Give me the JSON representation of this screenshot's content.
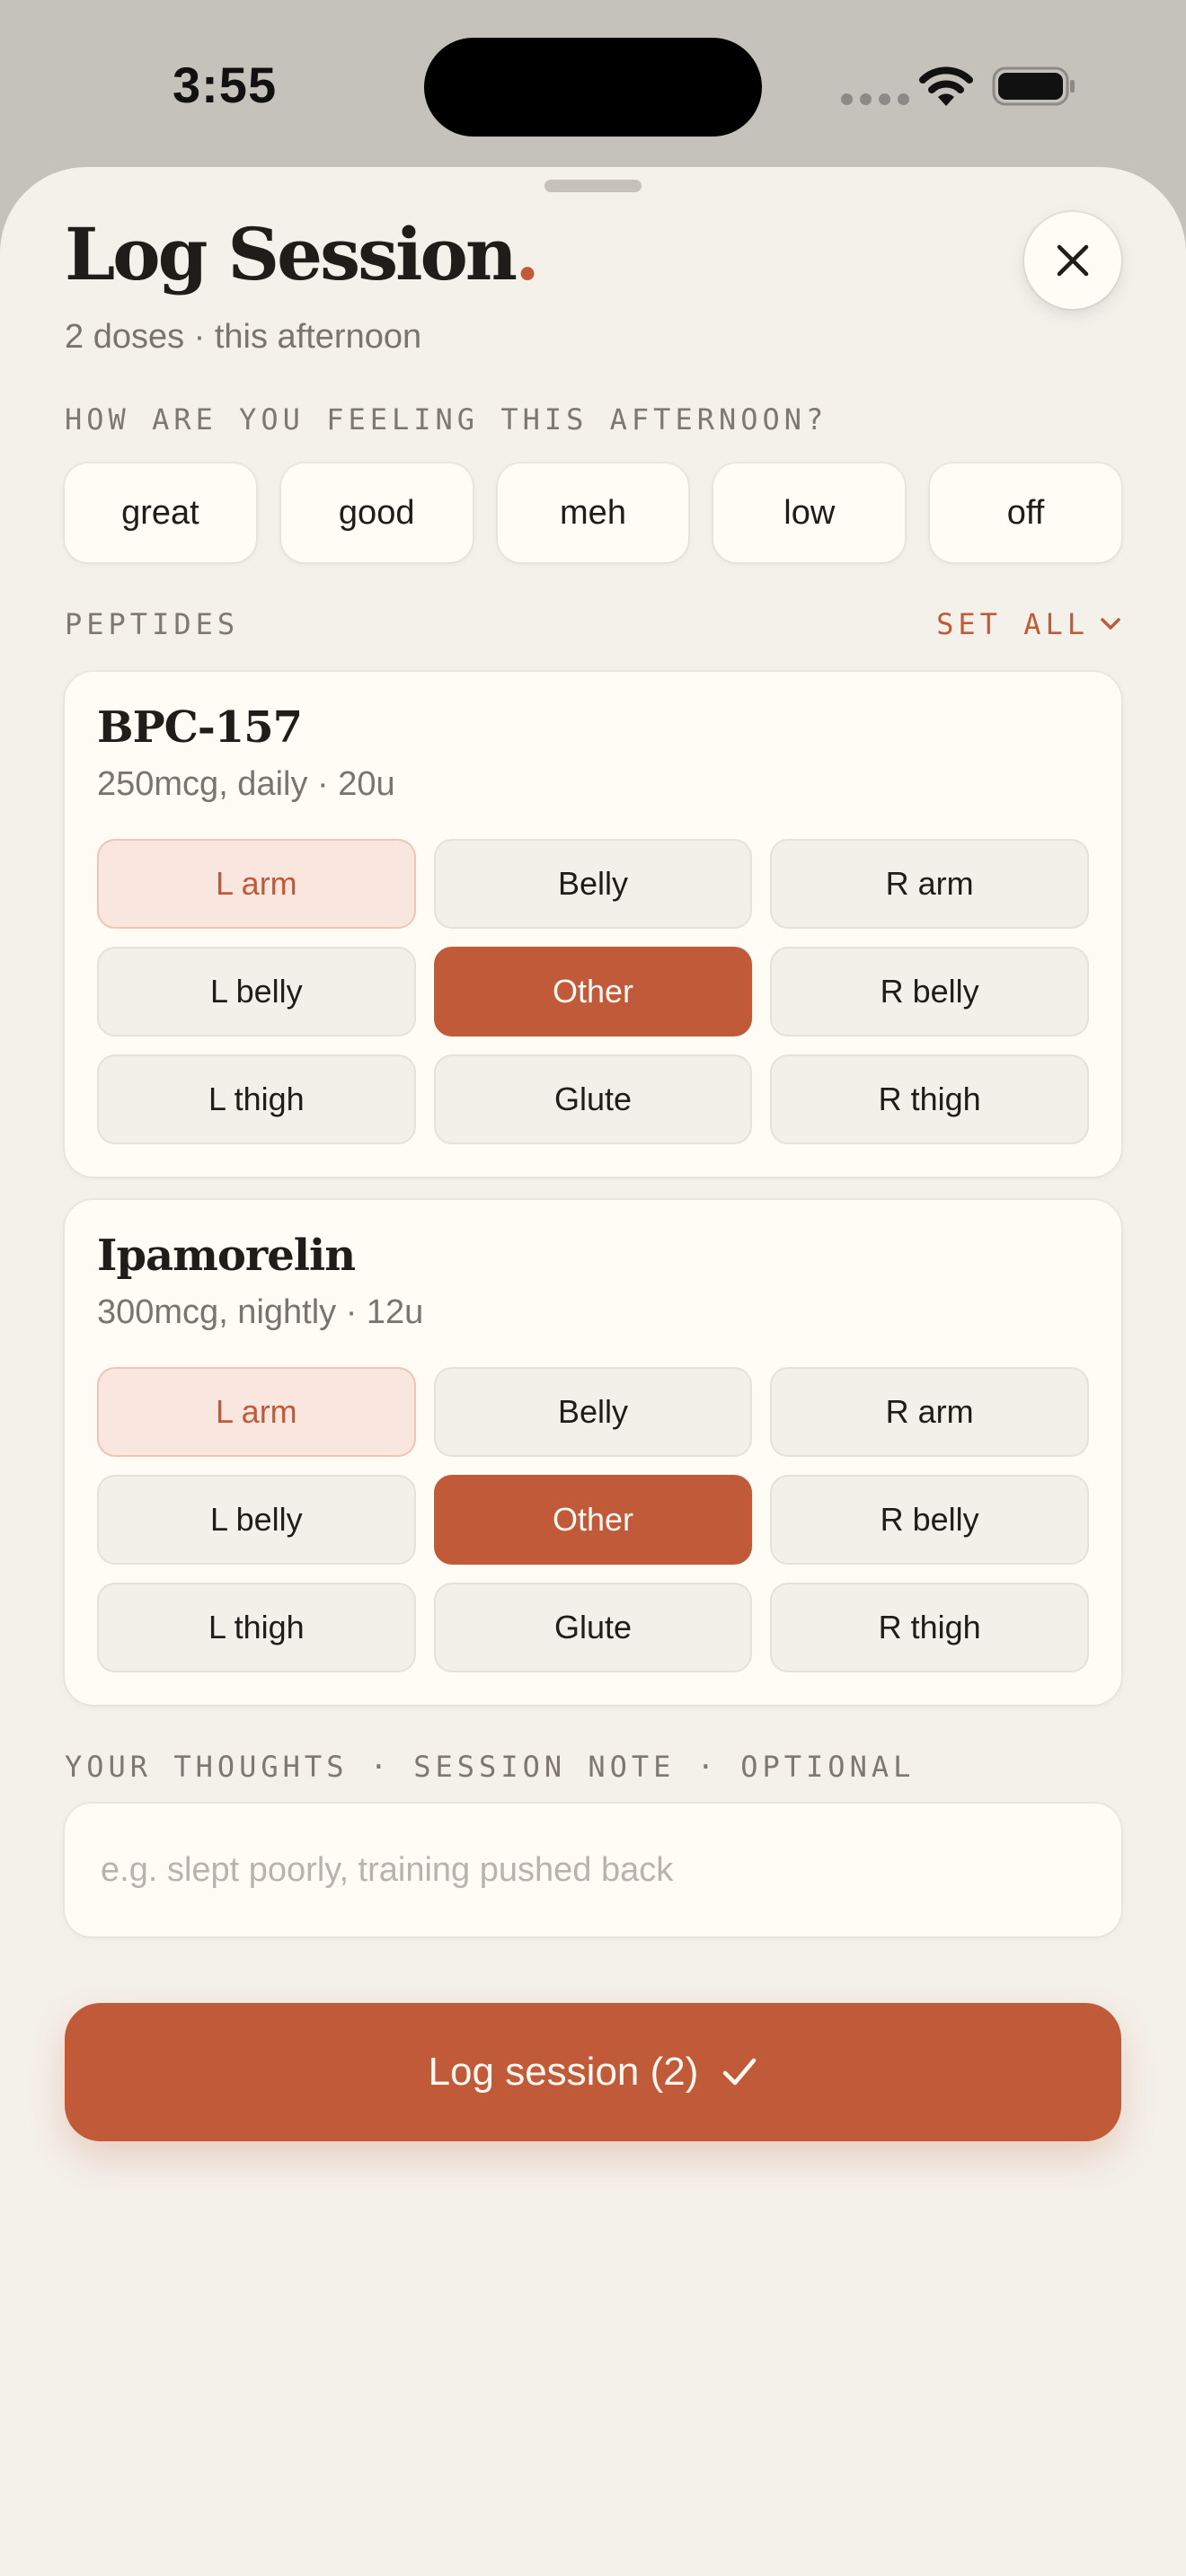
{
  "status_bar": {
    "time": "3:55"
  },
  "sheet": {
    "title": "Log Session",
    "title_dot": ".",
    "subtitle": "2 doses · this afternoon"
  },
  "mood": {
    "label": "HOW ARE YOU FEELING THIS AFTERNOON?",
    "options": [
      "great",
      "good",
      "meh",
      "low",
      "off"
    ]
  },
  "peptides": {
    "label": "PEPTIDES",
    "set_all_label": "SET ALL",
    "sites": [
      "L arm",
      "Belly",
      "R arm",
      "L belly",
      "Other",
      "R belly",
      "L thigh",
      "Glute",
      "R thigh"
    ],
    "items": [
      {
        "name": "BPC-157",
        "dose": "250mcg, daily · 20u",
        "last_site": "L arm",
        "selected_site": "Other"
      },
      {
        "name": "Ipamorelin",
        "dose": "300mcg, nightly · 12u",
        "last_site": "L arm",
        "selected_site": "Other"
      }
    ]
  },
  "note": {
    "label": "YOUR THOUGHTS · SESSION NOTE · OPTIONAL",
    "placeholder": "e.g. slept poorly, training pushed back",
    "value": ""
  },
  "submit": {
    "label": "Log session (2)"
  },
  "colors": {
    "accent": "#c05a38",
    "background": "#f4f0ea",
    "card": "#fffcf6"
  }
}
